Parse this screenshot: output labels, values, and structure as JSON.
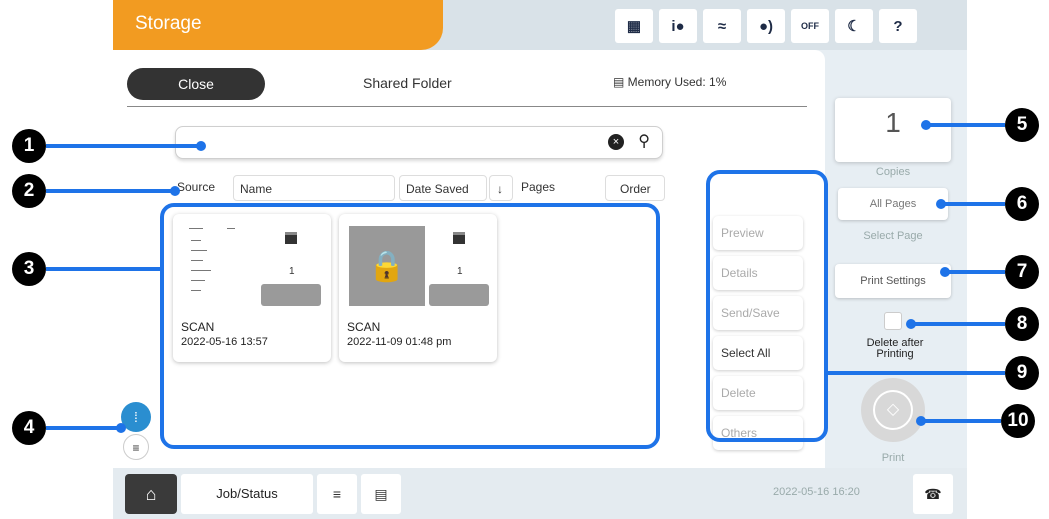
{
  "header": {
    "title": "Storage",
    "status_icons": [
      "ink-icon",
      "info-icon",
      "wifi-icon",
      "sound-icon",
      "quiet-off-icon",
      "moon-icon",
      "help-icon"
    ],
    "quiet_label": "OFF"
  },
  "panel": {
    "close_label": "Close",
    "title": "Shared Folder",
    "memory_label": "Memory Used: 1%"
  },
  "search": {
    "placeholder": ""
  },
  "sort": {
    "source_label": "Source",
    "name_label": "Name",
    "date_label": "Date Saved",
    "date_arrow": "↓",
    "pages_label": "Pages",
    "order_label": "Order"
  },
  "files": [
    {
      "name": "SCAN",
      "date": "2022-05-16 13:57",
      "pages": "1",
      "locked": false
    },
    {
      "name": "SCAN",
      "date": "2022-11-09 01:48 pm",
      "pages": "1",
      "locked": true
    }
  ],
  "actions": [
    {
      "label": "Preview",
      "enabled": false
    },
    {
      "label": "Details",
      "enabled": false
    },
    {
      "label": "Send/Save",
      "enabled": false
    },
    {
      "label": "Select All",
      "enabled": true
    },
    {
      "label": "Delete",
      "enabled": false
    },
    {
      "label": "Others",
      "enabled": false
    }
  ],
  "right": {
    "copies_value": "1",
    "copies_label": "Copies",
    "all_pages_label": "All Pages",
    "select_page_label": "Select Page",
    "print_settings_label": "Print Settings",
    "delete_after_printing_label": "Delete after Printing",
    "print_label": "Print"
  },
  "bottom": {
    "job_status_label": "Job/Status",
    "datetime": "2022-05-16 16:20"
  },
  "callouts": [
    "1",
    "2",
    "3",
    "4",
    "5",
    "6",
    "7",
    "8",
    "9",
    "10"
  ],
  "colors": {
    "accent": "#f29b21",
    "highlight": "#1e73e8",
    "grid_toggle": "#2a8ed0"
  }
}
